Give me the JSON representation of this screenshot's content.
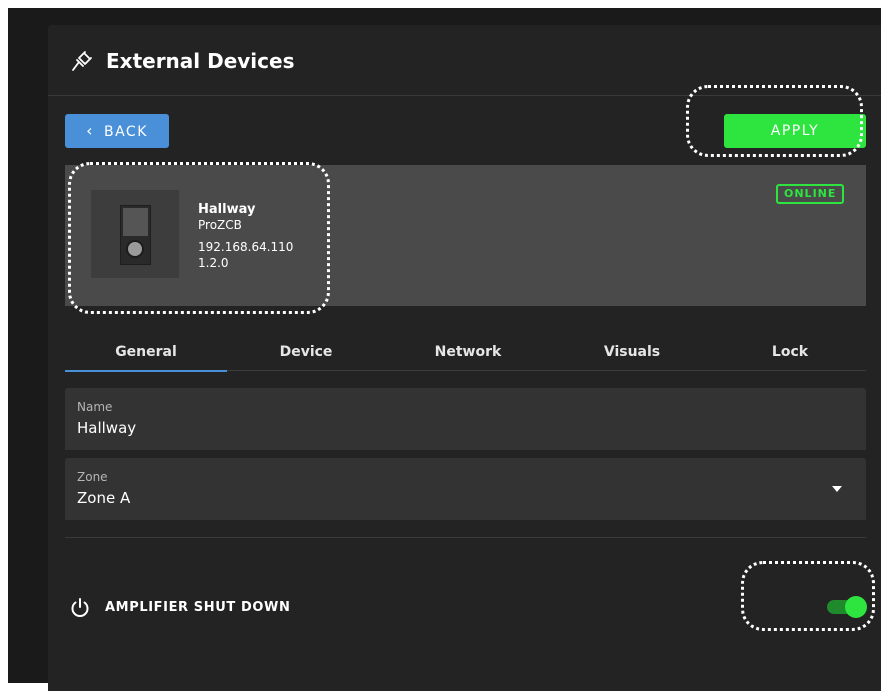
{
  "header": {
    "title": "External Devices",
    "icon": "plug-icon"
  },
  "toolbar": {
    "back_label": "BACK",
    "apply_label": "APPLY"
  },
  "device": {
    "name": "Hallway",
    "model": "ProZCB",
    "ip": "192.168.64.110",
    "version": "1.2.0",
    "status": "ONLINE"
  },
  "tabs": [
    {
      "label": "General",
      "active": true
    },
    {
      "label": "Device",
      "active": false
    },
    {
      "label": "Network",
      "active": false
    },
    {
      "label": "Visuals",
      "active": false
    },
    {
      "label": "Lock",
      "active": false
    }
  ],
  "fields": {
    "name": {
      "label": "Name",
      "value": "Hallway"
    },
    "zone": {
      "label": "Zone",
      "value": "Zone A"
    }
  },
  "amplifier": {
    "label": "AMPLIFIER SHUT DOWN",
    "enabled": true
  },
  "colors": {
    "accent_blue": "#4a90d9",
    "accent_green": "#2ee540",
    "background": "#232323",
    "card": "#4a4a4a"
  }
}
